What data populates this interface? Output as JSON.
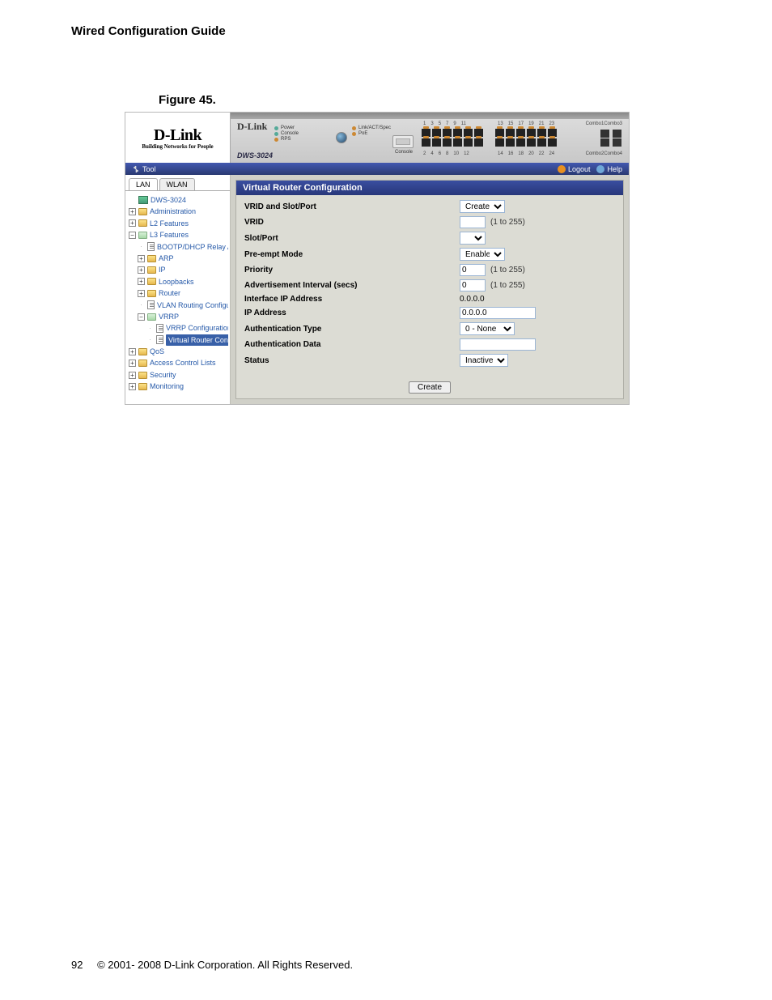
{
  "page": {
    "header": "Wired Configuration Guide",
    "figure_caption": "Figure 45.",
    "page_number": "92",
    "copyright": "© 2001- 2008 D-Link Corporation. All Rights Reserved."
  },
  "brand": {
    "name": "D-Link",
    "tagline": "Building Networks for People"
  },
  "device": {
    "label": "D-Link",
    "model": "DWS-3024",
    "leds": {
      "power": "Power",
      "console": "Console",
      "rps": "RPS",
      "link": "Link/ACT/Spec",
      "poe": "PoE"
    },
    "console_label": "Console",
    "port_top_left": [
      "1",
      "3",
      "5",
      "7",
      "9",
      "11"
    ],
    "port_bot_left": [
      "2",
      "4",
      "6",
      "8",
      "10",
      "12"
    ],
    "port_top_right": [
      "13",
      "15",
      "17",
      "19",
      "21",
      "23"
    ],
    "port_bot_right": [
      "14",
      "16",
      "18",
      "20",
      "22",
      "24"
    ],
    "combo_top": "Combo1Combo3",
    "combo_bot": "Combo2Combo4"
  },
  "toolbar": {
    "tool": "Tool",
    "logout": "Logout",
    "help": "Help"
  },
  "sidebar": {
    "tabs": {
      "lan": "LAN",
      "wlan": "WLAN"
    },
    "root": "DWS-3024",
    "admin": "Administration",
    "l2": "L2 Features",
    "l3": "L3 Features",
    "bootp": "BOOTP/DHCP Relay Agent",
    "arp": "ARP",
    "ip": "IP",
    "loopbacks": "Loopbacks",
    "router": "Router",
    "vlan_routing": "VLAN Routing Configurati",
    "vrrp": "VRRP",
    "vrrp_config": "VRRP Configuration",
    "virtual_router": "Virtual Router Configu",
    "qos": "QoS",
    "acl": "Access Control Lists",
    "security": "Security",
    "monitoring": "Monitoring"
  },
  "panel": {
    "title": "Virtual Router Configuration",
    "rows": {
      "vrid_slot": "VRID and Slot/Port",
      "vrid": "VRID",
      "slot_port": "Slot/Port",
      "preempt": "Pre-empt Mode",
      "priority": "Priority",
      "adv_int": "Advertisement Interval (secs)",
      "if_ip": "Interface IP Address",
      "ip_addr": "IP Address",
      "auth_type": "Authentication Type",
      "auth_data": "Authentication Data",
      "status": "Status"
    },
    "values": {
      "vrid_slot": "Create",
      "vrid_input": "",
      "vrid_hint": "(1 to 255)",
      "slot_port": "",
      "preempt": "Enable",
      "priority": "0",
      "priority_hint": "(1 to 255)",
      "adv_int": "0",
      "adv_int_hint": "(1 to 255)",
      "if_ip": "0.0.0.0",
      "ip_addr": "0.0.0.0",
      "auth_type": "0 - None",
      "auth_data": "",
      "status": "Inactive"
    },
    "create_btn": "Create"
  }
}
